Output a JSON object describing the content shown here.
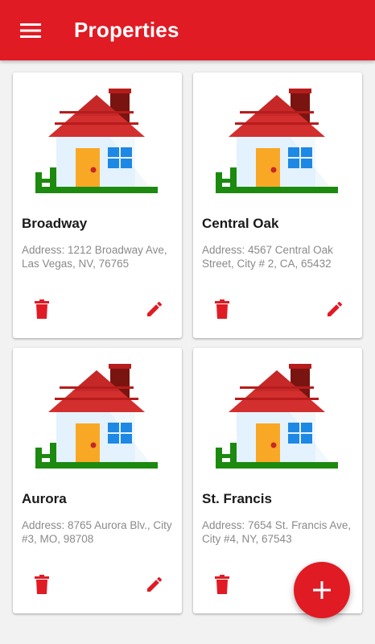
{
  "appbar": {
    "title": "Properties",
    "menu_icon": "hamburger-menu-icon",
    "color": "#e01b24"
  },
  "properties": [
    {
      "name": "Broadway",
      "address": "Address: 1212 Broadway Ave, Las Vegas, NV, 76765"
    },
    {
      "name": "Central Oak",
      "address": "Address: 4567 Central Oak Street, City # 2, CA, 65432"
    },
    {
      "name": "Aurora",
      "address": "Address: 8765 Aurora Blv., City #3, MO, 98708"
    },
    {
      "name": "St. Francis",
      "address": "Address: 7654 St. Francis Ave, City #4, NY, 67543"
    }
  ],
  "icons": {
    "house": "house-icon",
    "delete": "trash-icon",
    "edit": "pencil-icon",
    "add": "plus-icon"
  },
  "colors": {
    "accent": "#e01b24",
    "background": "#f2f2f2"
  }
}
